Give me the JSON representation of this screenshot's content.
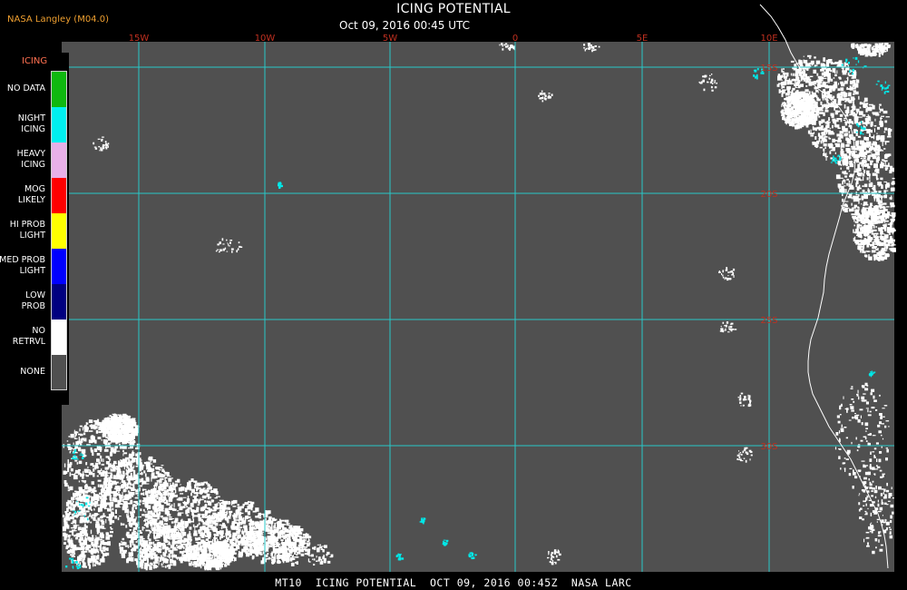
{
  "header": {
    "source": "NASA Langley (M04.0)",
    "title": "ICING POTENTIAL",
    "subtitle": "Oct 09, 2016 00:45 UTC"
  },
  "footer": {
    "caption": "MT10  ICING POTENTIAL  OCT 09, 2016 00:45Z  NASA LARC"
  },
  "legend": {
    "title": "ICING",
    "items": [
      {
        "label": "NO DATA",
        "color": "#0fb80f"
      },
      {
        "label": "NIGHT\nICING",
        "color": "#00f0f0"
      },
      {
        "label": "HEAVY\nICING",
        "color": "#e8b0e8"
      },
      {
        "label": "MOG\nLIKELY",
        "color": "#ff0000"
      },
      {
        "label": "HI PROB\nLIGHT",
        "color": "#ffff00"
      },
      {
        "label": "MED PROB\nLIGHT",
        "color": "#0000ff"
      },
      {
        "label": "LOW\nPROB",
        "color": "#000080"
      },
      {
        "label": "NO\nRETRVL",
        "color": "#ffffff"
      },
      {
        "label": "NONE",
        "color": "#505050"
      }
    ]
  },
  "map": {
    "background_color": "#505050",
    "grid_color": "#28c8c8",
    "coastline_color": "#ffffff",
    "cloud_color": "#ffffff",
    "icing_color": "#00e8e8",
    "label_color": "#c03020",
    "lon_labels": [
      "15W",
      "10W",
      "5W",
      "0",
      "5E",
      "10E"
    ],
    "lat_labels": [
      "15S",
      "20S",
      "25S",
      "30S"
    ]
  }
}
